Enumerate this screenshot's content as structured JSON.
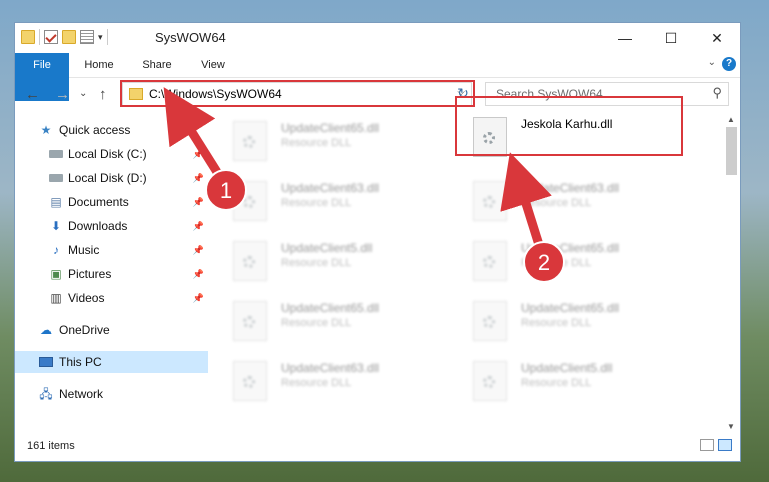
{
  "window": {
    "title": "SysWOW64",
    "controls": {
      "minimize": "—",
      "maximize": "☐",
      "close": "✕"
    }
  },
  "ribbon": {
    "tabs": [
      "File",
      "Home",
      "Share",
      "View"
    ],
    "help": "?"
  },
  "navigation": {
    "back": "←",
    "forward": "→",
    "recent": "⌄",
    "up": "↑",
    "address": "C:\\Windows\\SysWOW64",
    "search_placeholder": "Search SysWOW64"
  },
  "sidebar": {
    "items": [
      {
        "label": "Quick access",
        "icon": "star-icon"
      },
      {
        "label": "Local Disk (C:)",
        "icon": "disk-icon",
        "pinned": true
      },
      {
        "label": "Local Disk (D:)",
        "icon": "disk-icon",
        "pinned": true
      },
      {
        "label": "Documents",
        "icon": "documents-icon",
        "pinned": true
      },
      {
        "label": "Downloads",
        "icon": "download-icon",
        "pinned": true
      },
      {
        "label": "Music",
        "icon": "music-icon",
        "pinned": true
      },
      {
        "label": "Pictures",
        "icon": "pictures-icon",
        "pinned": true
      },
      {
        "label": "Videos",
        "icon": "videos-icon",
        "pinned": true
      },
      {
        "label": "OneDrive",
        "icon": "cloud-icon"
      },
      {
        "label": "This PC",
        "icon": "computer-icon",
        "selected": true
      },
      {
        "label": "Network",
        "icon": "network-icon"
      }
    ]
  },
  "files": {
    "target": {
      "name": "Jeskola Karhu.dll"
    },
    "blurred": [
      {
        "name": "UpdateClient65.dll",
        "type": "Resource DLL"
      },
      {
        "name": "UpdateClient63.dll",
        "type": "Resource DLL"
      },
      {
        "name": "UpdateClient5.dll",
        "type": "Resource DLL"
      },
      {
        "name": "UpdateClient65.dll",
        "type": "Resource DLL"
      },
      {
        "name": "UpdateClient63.dll",
        "type": "Resource DLL"
      },
      {
        "name": "UpdateClient63.dll",
        "type": "Resource DLL"
      },
      {
        "name": "UpdateClient65.dll",
        "type": "Resource DLL"
      },
      {
        "name": "UpdateClient5.dll",
        "type": "Resource DLL"
      },
      {
        "name": "UpdateClient65.dll",
        "type": "Resource DLL"
      }
    ]
  },
  "status": {
    "item_count": "161 items"
  },
  "annotations": {
    "step1": "1",
    "step2": "2",
    "accent": "#d9373b"
  }
}
